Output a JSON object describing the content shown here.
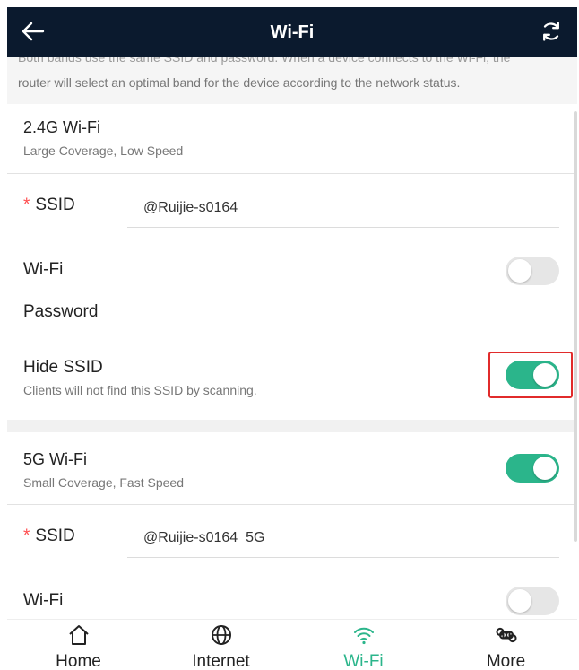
{
  "header": {
    "title": "Wi-Fi"
  },
  "notice": {
    "line1": "Both bands use the same SSID and password. When a device connects to the Wi-Fi, the",
    "line2": "router will select an optimal band for the device according to the network status."
  },
  "band24": {
    "title": "2.4G Wi-Fi",
    "subtitle": "Large Coverage, Low Speed",
    "ssid_label": "SSID",
    "ssid_value": "@Ruijie-s0164",
    "wifi_label": "Wi-Fi",
    "wifi_enabled": false,
    "password_label": "Password",
    "hide_label": "Hide SSID",
    "hide_sub": "Clients will not find this SSID by scanning.",
    "hide_enabled": true
  },
  "band5": {
    "title": "5G Wi-Fi",
    "subtitle": "Small Coverage, Fast Speed",
    "enabled": true,
    "ssid_label": "SSID",
    "ssid_value": "@Ruijie-s0164_5G",
    "wifi_label": "Wi-Fi",
    "wifi_enabled": false
  },
  "tabs": [
    {
      "label": "Home",
      "icon": "home-icon"
    },
    {
      "label": "Internet",
      "icon": "globe-icon"
    },
    {
      "label": "Wi-Fi",
      "icon": "wifi-icon",
      "active": true
    },
    {
      "label": "More",
      "icon": "command-icon"
    }
  ],
  "colors": {
    "header_bg": "#0b1a2e",
    "accent": "#2bb58b",
    "required": "#ff4d4f",
    "highlight": "#e12b2b"
  }
}
